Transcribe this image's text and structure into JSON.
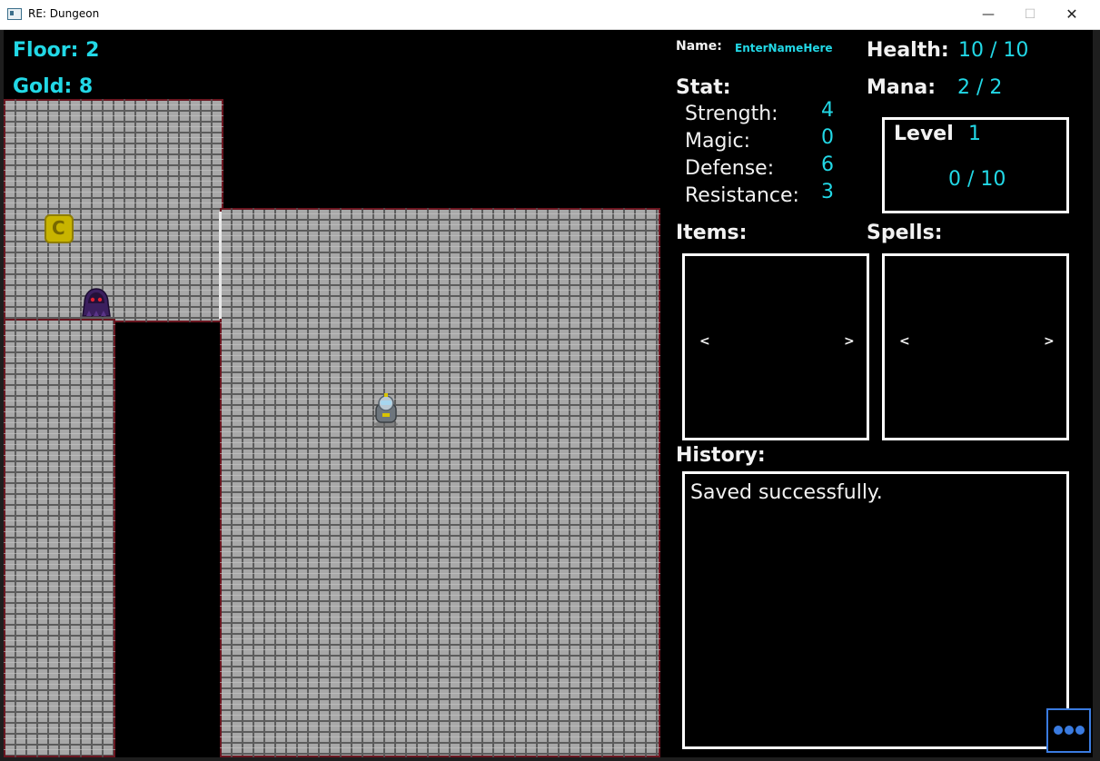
{
  "window": {
    "title": "RE: Dungeon",
    "minimize": "—",
    "maximize": "☐",
    "close": "✕"
  },
  "hud": {
    "floor": "Floor: 2",
    "gold": "Gold: 8"
  },
  "panel": {
    "name_label": "Name:",
    "name_value": "EnterNameHere",
    "health_label": "Health:",
    "health_value": "10 / 10",
    "mana_label": "Mana:",
    "mana_value": "2 / 2",
    "stat_label": "Stat:",
    "stats": [
      {
        "label": "Strength:",
        "value": "4"
      },
      {
        "label": "Magic:",
        "value": "0"
      },
      {
        "label": "Defense:",
        "value": "6"
      },
      {
        "label": "Resistance:",
        "value": "3"
      }
    ],
    "level_label": "Level",
    "level_value": "1",
    "xp": "0 / 10",
    "items_label": "Items:",
    "spells_label": "Spells:",
    "prev": "<",
    "next": ">",
    "history_label": "History:",
    "history_lines": [
      "Saved successfully."
    ]
  },
  "colors": {
    "accent_cyan": "#22d8e6",
    "wall_edge": "#6a1620",
    "button_blue": "#3a7be0"
  },
  "icons": [
    "gold-coin-icon",
    "ghost-enemy-icon",
    "player-robot-icon",
    "more-dots-icon"
  ]
}
